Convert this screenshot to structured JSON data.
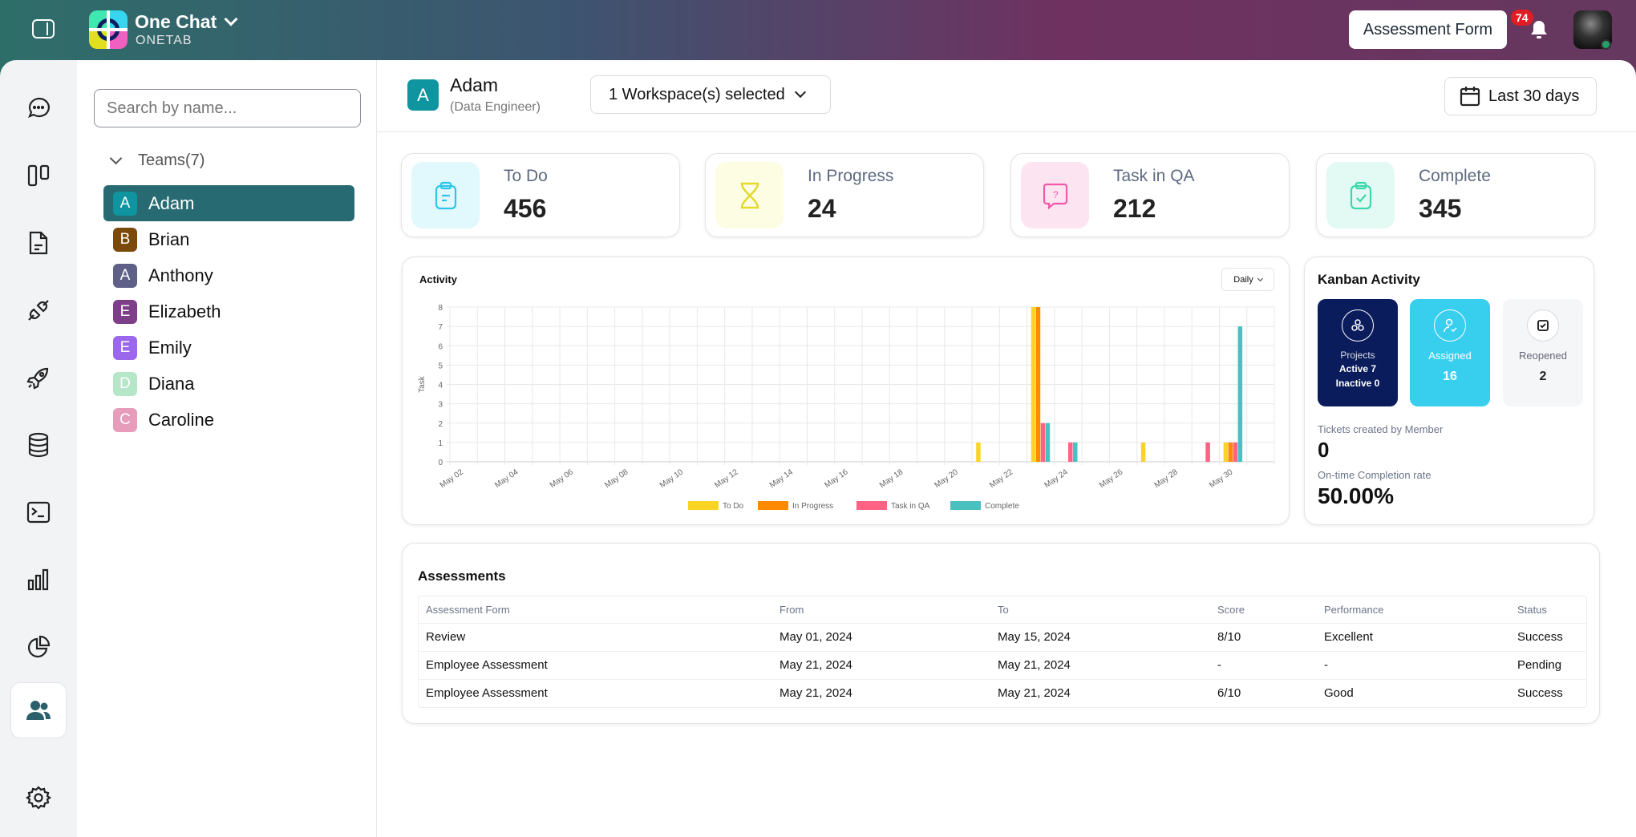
{
  "header": {
    "app_name": "One Chat",
    "workspace": "ONETAB",
    "assessment_button": "Assessment Form",
    "notification_count": "74"
  },
  "rail": {
    "items": [
      "chat-icon",
      "board-icon",
      "document-icon",
      "plug-icon",
      "rocket-icon",
      "database-icon",
      "image-icon",
      "bar-chart-icon",
      "pie-chart-icon",
      "users-icon",
      "gear-icon"
    ],
    "active": "users-icon"
  },
  "team_panel": {
    "search_placeholder": "Search by name...",
    "teams_label": "Teams(7)",
    "members": [
      {
        "initial": "A",
        "name": "Adam",
        "color": "#0e95a0",
        "selected": true
      },
      {
        "initial": "B",
        "name": "Brian",
        "color": "#7a4a0a"
      },
      {
        "initial": "A",
        "name": "Anthony",
        "color": "#5f6088"
      },
      {
        "initial": "E",
        "name": "Elizabeth",
        "color": "#7c3f88"
      },
      {
        "initial": "E",
        "name": "Emily",
        "color": "#9b67ec"
      },
      {
        "initial": "D",
        "name": "Diana",
        "color": "#b5e6c8"
      },
      {
        "initial": "C",
        "name": "Caroline",
        "color": "#e79cbb"
      }
    ]
  },
  "profile": {
    "initial": "A",
    "name": "Adam",
    "role": "(Data Engineer)",
    "workspace_select": "1 Workspace(s) selected",
    "date_range": "Last 30 days"
  },
  "stats": [
    {
      "label": "To Do",
      "value": "456",
      "bg": "#e1f8fd",
      "color": "#2ec5e8"
    },
    {
      "label": "In Progress",
      "value": "24",
      "bg": "#fdfde3",
      "color": "#e3da2d"
    },
    {
      "label": "Task in QA",
      "value": "212",
      "bg": "#fde4f1",
      "color": "#f05aa8"
    },
    {
      "label": "Complete",
      "value": "345",
      "bg": "#e2faf3",
      "color": "#3ed6ad"
    }
  ],
  "activity": {
    "title": "Activity",
    "period": "Daily"
  },
  "chart_data": {
    "type": "bar",
    "ylabel": "Task",
    "ylim": [
      0,
      8
    ],
    "yticks": [
      0,
      1,
      2,
      3,
      4,
      5,
      6,
      7,
      8
    ],
    "categories": [
      "May 02",
      "May 03",
      "May 04",
      "May 05",
      "May 06",
      "May 07",
      "May 08",
      "May 09",
      "May 10",
      "May 11",
      "May 12",
      "May 13",
      "May 14",
      "May 15",
      "May 16",
      "May 17",
      "May 18",
      "May 19",
      "May 20",
      "May 21",
      "May 22",
      "May 23",
      "May 24",
      "May 25",
      "May 26",
      "May 27",
      "May 28",
      "May 29",
      "May 30",
      "May 31"
    ],
    "tick_labels": [
      "May 02",
      "May 04",
      "May 06",
      "May 08",
      "May 10",
      "May 12",
      "May 14",
      "May 16",
      "May 18",
      "May 20",
      "May 22",
      "May 24",
      "May 26",
      "May 28",
      "May 30"
    ],
    "grid": true,
    "legend": "bottom",
    "series": [
      {
        "name": "To Do",
        "color": "#f9d423",
        "values": [
          0,
          0,
          0,
          0,
          0,
          0,
          0,
          0,
          0,
          0,
          0,
          0,
          0,
          0,
          0,
          0,
          0,
          0,
          0,
          1,
          0,
          8,
          0,
          0,
          0,
          1,
          0,
          0,
          1,
          0
        ]
      },
      {
        "name": "In Progress",
        "color": "#fd8a00",
        "values": [
          0,
          0,
          0,
          0,
          0,
          0,
          0,
          0,
          0,
          0,
          0,
          0,
          0,
          0,
          0,
          0,
          0,
          0,
          0,
          0,
          0,
          8,
          0,
          0,
          0,
          0,
          0,
          0,
          1,
          0
        ]
      },
      {
        "name": "Task in QA",
        "color": "#fe6384",
        "values": [
          0,
          0,
          0,
          0,
          0,
          0,
          0,
          0,
          0,
          0,
          0,
          0,
          0,
          0,
          0,
          0,
          0,
          0,
          0,
          0,
          0,
          2,
          1,
          0,
          0,
          0,
          0,
          1,
          1,
          0
        ]
      },
      {
        "name": "Complete",
        "color": "#4bc0c0",
        "values": [
          0,
          0,
          0,
          0,
          0,
          0,
          0,
          0,
          0,
          0,
          0,
          0,
          0,
          0,
          0,
          0,
          0,
          0,
          0,
          0,
          0,
          2,
          1,
          0,
          0,
          0,
          0,
          0,
          7,
          0
        ]
      }
    ]
  },
  "kanban": {
    "title": "Kanban Activity",
    "projects_label": "Projects",
    "active": "Active 7",
    "inactive": "Inactive 0",
    "assigned_label": "Assigned",
    "assigned_value": "16",
    "reopened_label": "Reopened",
    "reopened_value": "2",
    "tickets_label": "Tickets created by Member",
    "tickets_value": "0",
    "completion_label": "On-time Completion rate",
    "completion_value": "50.00%"
  },
  "assessments": {
    "title": "Assessments",
    "columns": [
      "Assessment Form",
      "From",
      "To",
      "Score",
      "Performance",
      "Status"
    ],
    "rows": [
      [
        "Review",
        "May 01, 2024",
        "May 15, 2024",
        "8/10",
        "Excellent",
        "Success"
      ],
      [
        "Employee Assessment",
        "May 21, 2024",
        "May 21, 2024",
        "-",
        "-",
        "Pending"
      ],
      [
        "Employee Assessment",
        "May 21, 2024",
        "May 21, 2024",
        "6/10",
        "Good",
        "Success"
      ]
    ]
  }
}
